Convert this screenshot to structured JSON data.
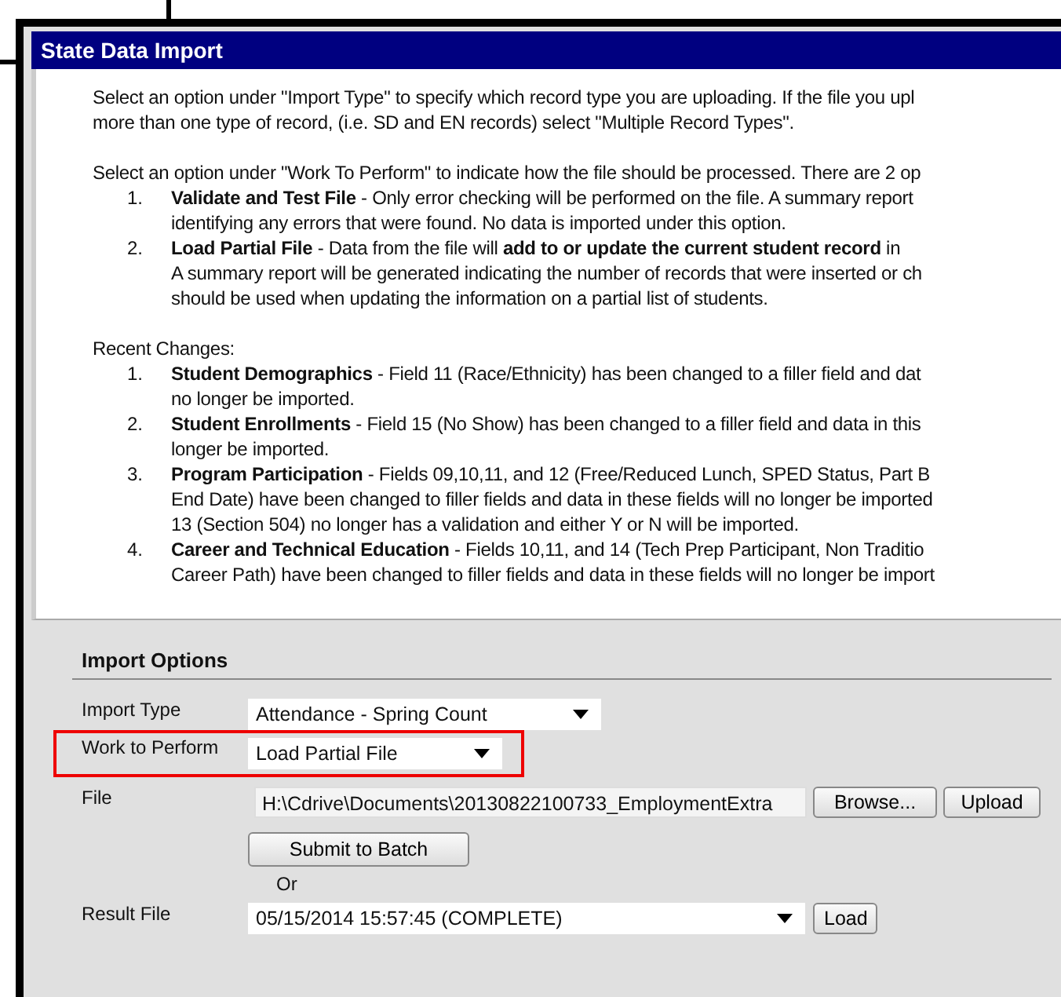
{
  "window": {
    "title": "State Data Import"
  },
  "instructions": {
    "paragraphs": [
      [
        "Select an option under \"Import Type\" to specify which record type you are uploading. If the file you upl",
        "more than one type of record, (i.e. SD and EN records) select \"Multiple Record Types\"."
      ],
      [
        "Select an option under \"Work To Perform\" to indicate how the file should be processed. There are 2 op"
      ]
    ],
    "work_options": [
      {
        "number": "1.",
        "lines": [
          "**Validate and Test File** - Only error checking will be performed on the file. A summary report",
          "identifying any errors that were found. No data is imported under this option."
        ]
      },
      {
        "number": "2.",
        "lines": [
          "**Load Partial File** - Data from the file will **add to or update the current student record** in",
          "A summary report will be generated indicating the number of records that were inserted or ch",
          "should be used when updating the information on a partial list of students."
        ]
      }
    ],
    "recent_changes_label": "Recent Changes:",
    "recent_changes": [
      {
        "number": "1.",
        "lines": [
          "**Student Demographics** - Field 11 (Race/Ethnicity) has been changed to a filler field and dat",
          "no longer be imported."
        ]
      },
      {
        "number": "2.",
        "lines": [
          "**Student Enrollments** - Field 15 (No Show) has been changed to a filler field and data in this",
          "longer be imported."
        ]
      },
      {
        "number": "3.",
        "lines": [
          "**Program Participation** - Fields 09,10,11, and 12 (Free/Reduced Lunch, SPED Status, Part B",
          "End Date) have been changed to filler fields and data in these fields will no longer be imported",
          "13 (Section 504) no longer has a validation and either Y or N will be imported."
        ]
      },
      {
        "number": "4.",
        "lines": [
          "**Career and Technical Education** - Fields 10,11, and 14 (Tech Prep Participant, Non Traditio",
          "Career Path) have been changed to filler fields and data in these fields will no longer be import"
        ]
      }
    ]
  },
  "import_options": {
    "heading": "Import Options",
    "fields": [
      {
        "kind": "select",
        "label": "Import Type",
        "value": "Attendance - Spring Count",
        "highlighted": false
      },
      {
        "kind": "select",
        "label": "Work to Perform",
        "value": "Load Partial File",
        "highlighted": true
      },
      {
        "kind": "file",
        "label": "File",
        "value": "H:\\Cdrive\\Documents\\20130822100733_EmploymentExtra",
        "buttons": [
          "Browse...",
          "Upload"
        ]
      }
    ],
    "submit_button": "Submit to Batch",
    "or_text": "Or",
    "result": {
      "label": "Result File",
      "value": "05/15/2014 15:57:45 (COMPLETE)",
      "button": "Load"
    }
  }
}
